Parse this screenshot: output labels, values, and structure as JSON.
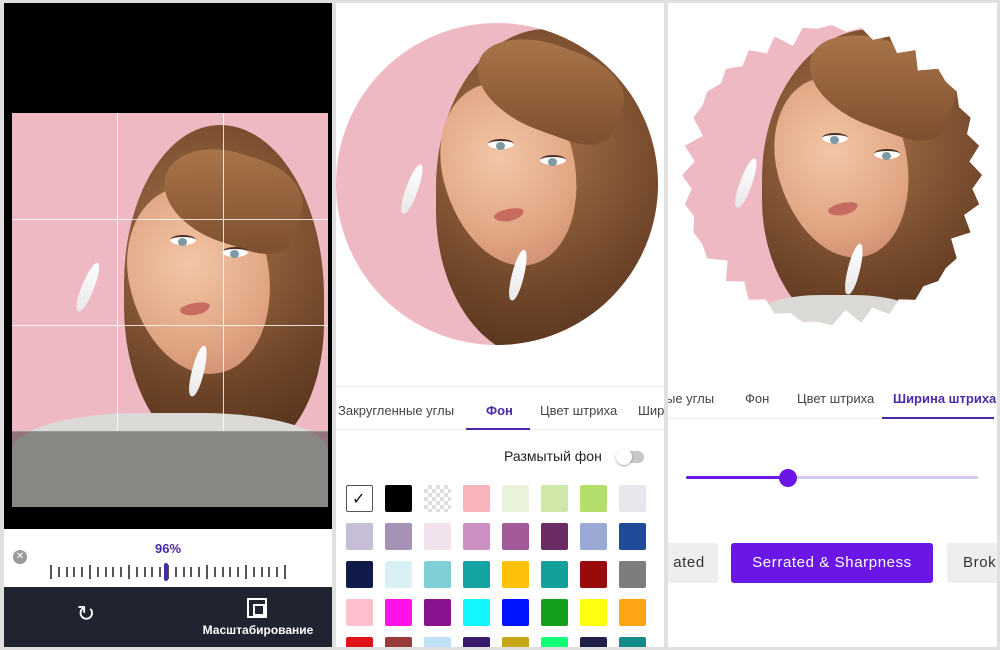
{
  "panel1": {
    "zoom_percent": "96%",
    "zoom_value_pct": 96,
    "zoom_button_label": "Масштабирование",
    "icons": [
      "reset-x-icon",
      "refresh-icon",
      "fit-screen-icon"
    ]
  },
  "panel2": {
    "tabs": [
      "Закругленные углы",
      "Фон",
      "Цвет штриха",
      "Шир"
    ],
    "active_tab": "Фон",
    "blur_label": "Размытый фон",
    "blur_enabled": false,
    "swatch_colors": [
      "#ffffff",
      "#000000",
      "transparent",
      "#f7b5bb",
      "#e9f3d9",
      "#cfe7a8",
      "#b4de6c",
      "#e6e6ec",
      "#c6bed6",
      "#a592b4",
      "#f2e2ee",
      "#cb90c2",
      "#a35a9a",
      "#6a2a64",
      "#9aa9d6",
      "#1f4b9a",
      "#111b4a",
      "#d9f1f5",
      "#7fd0d6",
      "#13a3a3",
      "#ffc107",
      "#11a09a",
      "#9b0a0a",
      "#7d7d7d",
      "#ffbfcc",
      "#ff13ea",
      "#88138e",
      "#13f5ff",
      "#0013ff",
      "#13a01b",
      "#ffff13",
      "#ffa413",
      "#e0131b",
      "#9a3a3a",
      "#bfe1f5",
      "#3a1a6a",
      "#c7a71a",
      "#13ff7a",
      "#20204a",
      "#138a8a"
    ]
  },
  "panel3": {
    "tabs": [
      "ые углы",
      "Фон",
      "Цвет штриха",
      "Ширина штриха"
    ],
    "active_tab": "Ширина штриха",
    "stroke_width_value": 0.35,
    "style_buttons": [
      "ated",
      "Serrated & Sharpness",
      "Brok"
    ],
    "active_style": "Serrated & Sharpness",
    "accent": "#6a16e6"
  }
}
